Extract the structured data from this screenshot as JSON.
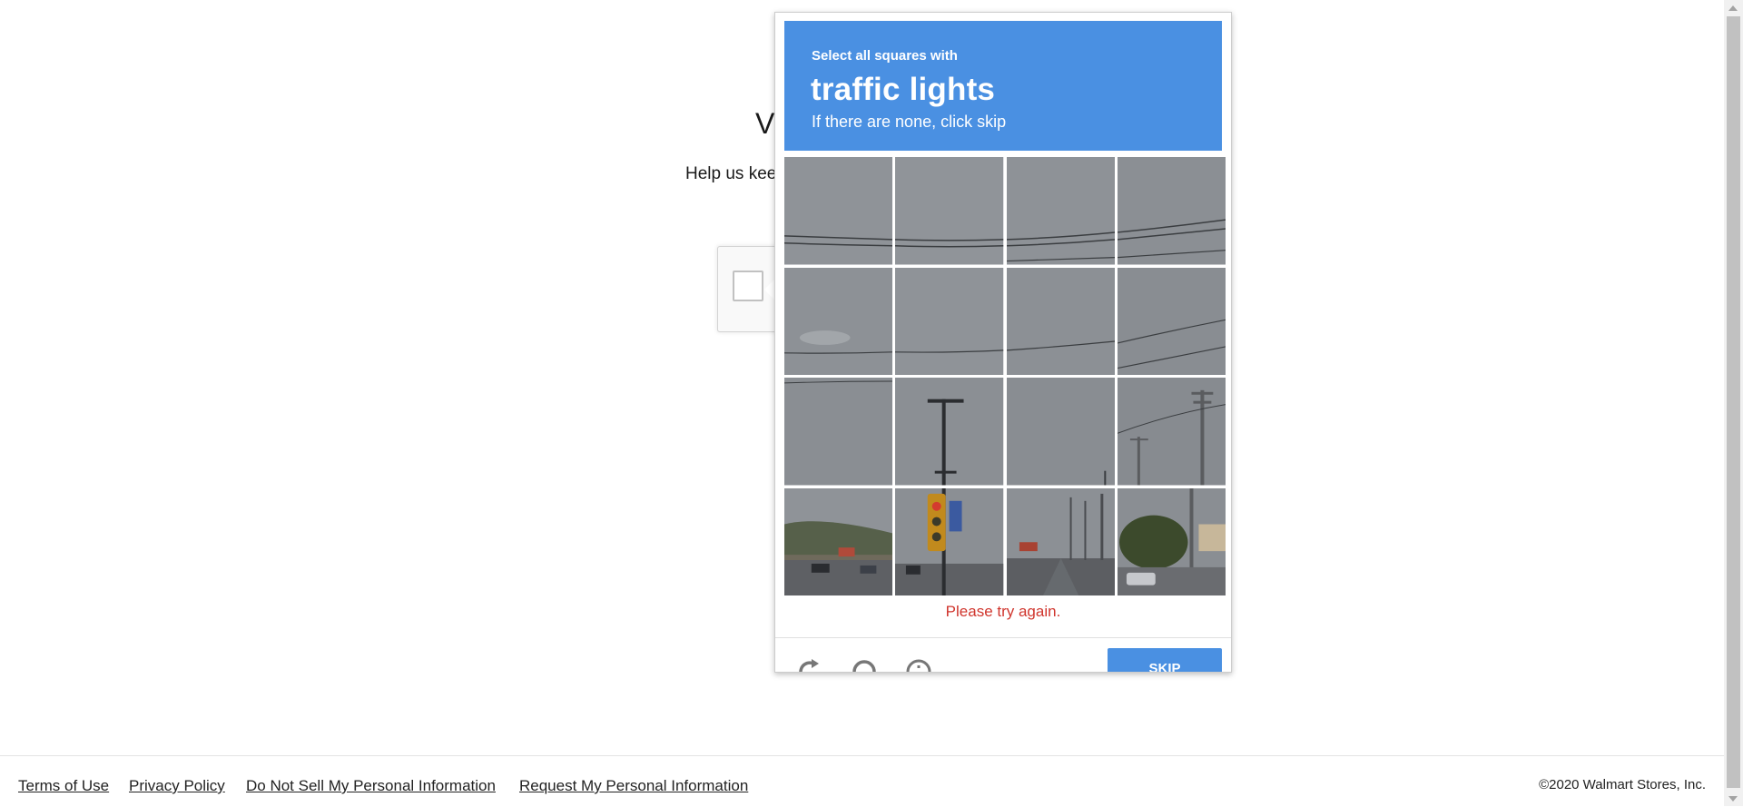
{
  "page": {
    "heading": "Ve",
    "subtext": "Help us kee"
  },
  "challenge": {
    "instruction_line1": "Select all squares with",
    "instruction_object": "traffic lights",
    "instruction_line3": "If there are none, click skip",
    "error": "Please try again.",
    "skip_label": "SKIP",
    "accent_color": "#4a90e2",
    "error_color": "#d0352d",
    "icons": [
      "reload-icon",
      "audio-icon",
      "info-icon"
    ]
  },
  "footer": {
    "links": [
      "Terms of Use",
      "Privacy Policy",
      "Do Not Sell My Personal Information",
      "Request My Personal Information"
    ],
    "copyright": "©2020 Walmart Stores, Inc."
  }
}
